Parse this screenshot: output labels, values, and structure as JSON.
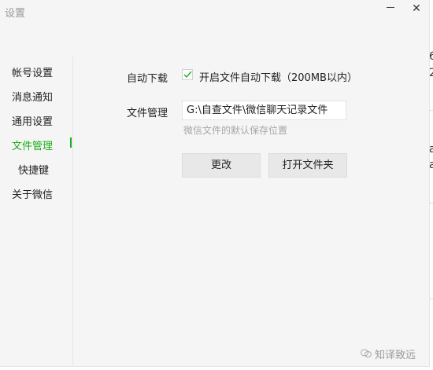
{
  "window": {
    "title": "设置",
    "minimize_label": "",
    "close_label": "✕"
  },
  "sidebar": {
    "items": [
      {
        "label": "帐号设置"
      },
      {
        "label": "消息通知"
      },
      {
        "label": "通用设置"
      },
      {
        "label": "文件管理"
      },
      {
        "label": "快捷键"
      },
      {
        "label": "关于微信"
      }
    ],
    "active_index": 3
  },
  "file_settings": {
    "auto_download_label": "自动下载",
    "auto_download_checked": true,
    "auto_download_option": "开启文件自动下载（200MB以内）",
    "file_manage_label": "文件管理",
    "path_value": "G:\\自查文件\\微信聊天记录文件",
    "path_hint": "微信文件的默认保存位置",
    "change_button": "更改",
    "open_folder_button": "打开文件夹"
  },
  "background": {
    "right_frag_1": "6",
    "right_frag_2": "2",
    "right_frag_3": "a",
    "right_frag_4": "a"
  },
  "watermark": {
    "text": "知译致远"
  },
  "colors": {
    "accent": "#1aad19",
    "window_bg": "#f5f5f5",
    "hint": "#a6a6a6"
  }
}
